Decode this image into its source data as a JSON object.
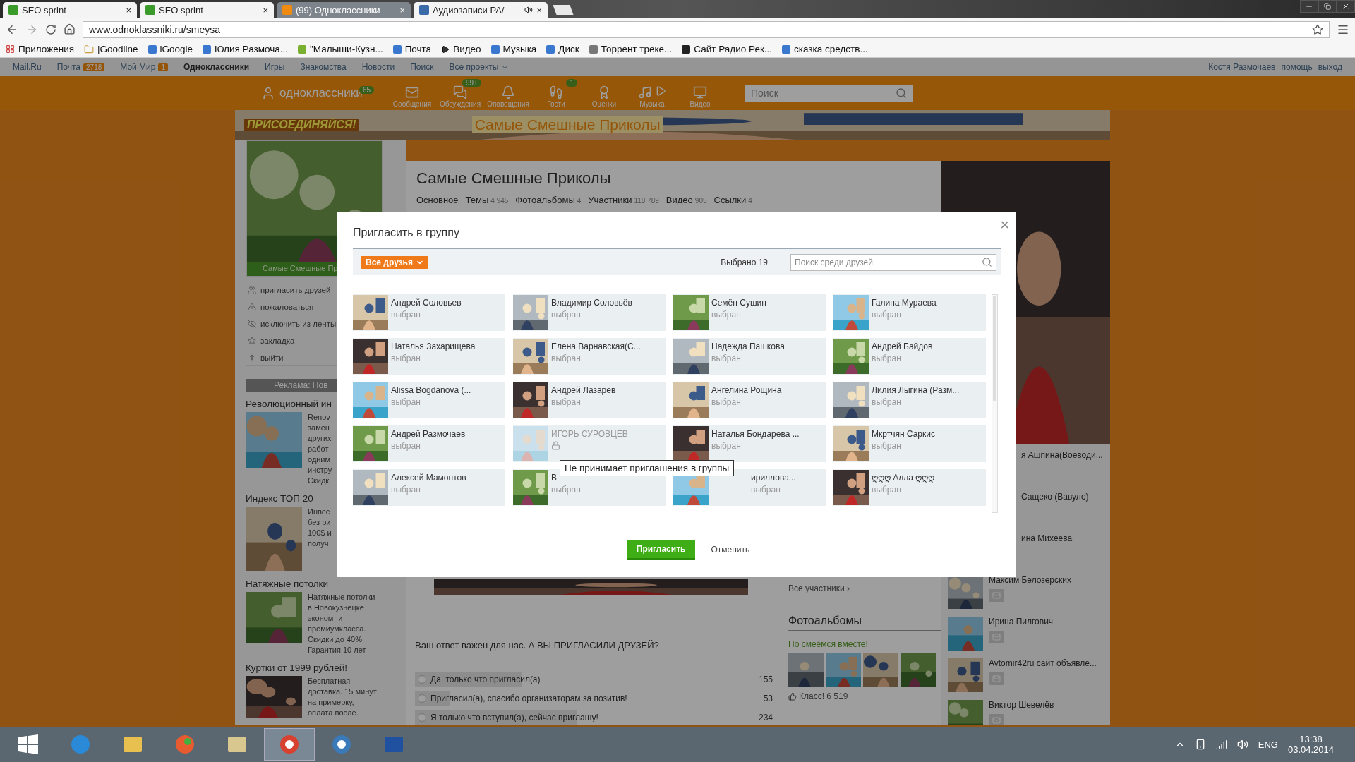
{
  "browser": {
    "tabs": [
      {
        "title": "SEO sprint",
        "kind": "seo",
        "playing": false,
        "close": "×",
        "selected": false
      },
      {
        "title": "SEO sprint",
        "kind": "seo",
        "playing": false,
        "close": "×",
        "selected": false
      },
      {
        "title": "(99) Одноклассники",
        "kind": "ok",
        "playing": false,
        "close": "×",
        "selected": true
      },
      {
        "title": "Аудиозаписи РА/",
        "kind": "audio",
        "playing": true,
        "close": "×",
        "selected": false
      }
    ],
    "address": "www.odnoklassniki.ru/smeysa",
    "bookmarks": [
      {
        "label": "Приложения",
        "kind": "apps"
      },
      {
        "label": "|Goodline",
        "kind": "folder"
      },
      {
        "label": "iGoogle",
        "kind": "site",
        "color": "#3a78d0"
      },
      {
        "label": "Юлия Размоча...",
        "kind": "site",
        "color": "#3a78d0"
      },
      {
        "label": "\"Малыши-Кузн...",
        "kind": "site",
        "color": "#7ab030"
      },
      {
        "label": "Почта",
        "kind": "site",
        "color": "#3a78d0"
      },
      {
        "label": "Видео",
        "kind": "play"
      },
      {
        "label": "Музыка",
        "kind": "site",
        "color": "#3a78d0"
      },
      {
        "label": "Диск",
        "kind": "site",
        "color": "#3a78d0"
      },
      {
        "label": "Торрент треке...",
        "kind": "site",
        "color": "#777777"
      },
      {
        "label": "Сайт Радио Рек...",
        "kind": "site",
        "color": "#222222"
      },
      {
        "label": "сказка средств...",
        "kind": "site",
        "color": "#3a78d0"
      }
    ]
  },
  "top_links": [
    {
      "label": "Mail.Ru",
      "selected": false
    },
    {
      "label": "Почта",
      "badge": "2718",
      "selected": false
    },
    {
      "label": "Мой Мир",
      "badge": "1",
      "selected": false
    },
    {
      "label": "Одноклассники",
      "selected": true
    },
    {
      "label": "Игры",
      "selected": false
    },
    {
      "label": "Знакомства",
      "selected": false
    },
    {
      "label": "Новости",
      "selected": false
    },
    {
      "label": "Поиск",
      "selected": false
    },
    {
      "label": "Все проекты",
      "dropdown": true,
      "selected": false
    }
  ],
  "user_links": [
    "Костя Размочаев",
    "помощь",
    "выход"
  ],
  "header": {
    "logo": "одноклассники",
    "logo_badge": "65",
    "nav": [
      {
        "label": "Сообщения",
        "kind": "mail"
      },
      {
        "label": "Обсуждения",
        "kind": "chat",
        "badge": "99+"
      },
      {
        "label": "Оповещения",
        "kind": "bell"
      },
      {
        "label": "Гости",
        "kind": "steps",
        "badge": "1"
      },
      {
        "label": "Оценки",
        "kind": "medal"
      },
      {
        "label": "Музыка",
        "kind": "music"
      },
      {
        "label": "Видео",
        "kind": "video"
      }
    ],
    "search_placeholder": "Поиск"
  },
  "banner": {
    "slogan": "ПРИСОЕДИНЯЙСЯ!",
    "title": "Самые Смешные Приколы"
  },
  "group": {
    "caption": "Самые Смешные Пр",
    "menu": [
      {
        "label": "пригласить друзей",
        "kind": "users"
      },
      {
        "label": "пожаловаться",
        "kind": "warn"
      },
      {
        "label": "исключить из ленты",
        "kind": "hide"
      },
      {
        "label": "закладка",
        "kind": "star"
      },
      {
        "label": "выйти",
        "kind": "walk"
      }
    ],
    "ads_header": "Реклама: Нов",
    "ads": [
      {
        "title": "Революционный ин",
        "text": "Renov\nзамен\nдругих\nработ\nодним\nинстру\nСкидк"
      },
      {
        "title": "Индекс ТОП 20",
        "text": "Инвес\nбез ри\n100$ и\nполуч"
      },
      {
        "title": "Натяжные потолки",
        "text": "Натяжные потолки\nв Новокузнецке\nэконом- и\nпремиумкласса.\nСкидки до 40%.\nГарантия 10 лет"
      },
      {
        "title": "Куртки от 1999 рублей!",
        "text": "Бесплатная\nдоставка. 15 минут\nна примерку,\nоплата после."
      }
    ],
    "title": "Самые Смешные Приколы",
    "nav": [
      {
        "label": "Основное"
      },
      {
        "label": "Темы",
        "count": "4 945"
      },
      {
        "label": "Фотоальбомы",
        "count": "4"
      },
      {
        "label": "Участники",
        "count": "118 789"
      },
      {
        "label": "Видео",
        "count": "905"
      },
      {
        "label": "Ссылки",
        "count": "4"
      }
    ],
    "poll": {
      "question": "Ваш ответ важен для нас. А ВЫ ПРИГЛАСИЛИ ДРУЗЕЙ?",
      "options": [
        {
          "label": "Да, только что пригласил(а)",
          "count": "155",
          "level": 0.33,
          "checked": false
        },
        {
          "label": "Пригласил(а), спасибо организаторам за позитив!",
          "count": "53",
          "level": 0.11,
          "checked": false
        },
        {
          "label": "Я только что вступил(а), сейчас приглашу!",
          "count": "234",
          "level": 0.5,
          "checked": false
        }
      ]
    },
    "all_members": "Все участники ›",
    "albums_title": "Фотоальбомы",
    "album_name": "По смеёмся вместе!",
    "klass": "Класс! 6 519",
    "members": [
      {
        "name": "я Ашпина(Воеводи...",
        "kind": "cut"
      },
      {
        "name": "Сащеко (Вавуло)",
        "kind": "cut"
      },
      {
        "name": "ина Михеева",
        "kind": "cut"
      },
      {
        "name": "Максим Белозерских",
        "kind": "full"
      },
      {
        "name": "Ирина Пилгович",
        "kind": "full"
      },
      {
        "name": "Avtomir42ru сайт объявле...",
        "kind": "full"
      },
      {
        "name": "Виктор Шевелёв",
        "kind": "full"
      }
    ]
  },
  "dialog": {
    "title": "Пригласить в группу",
    "close": "×",
    "filter": "Все друзья",
    "selected_count": "Выбрано 19",
    "search_placeholder": "Поиск среди друзей",
    "friends": [
      {
        "name": "Андрей Соловьев",
        "status": "выбран",
        "disabled": false
      },
      {
        "name": "Владимир Соловьёв",
        "status": "выбран",
        "disabled": false
      },
      {
        "name": "Семён Сушин",
        "status": "выбран",
        "disabled": false
      },
      {
        "name": "Галина Мураева",
        "status": "выбран",
        "disabled": false
      },
      {
        "name": "Наталья Захарищева",
        "status": "выбран",
        "disabled": false
      },
      {
        "name": "Елена Варнавская(С...",
        "status": "выбран",
        "disabled": false
      },
      {
        "name": "Надежда Пашкова",
        "status": "выбран",
        "disabled": false
      },
      {
        "name": "Андрей Байдов",
        "status": "выбран",
        "disabled": false
      },
      {
        "name": "Alissa Bogdanova (...",
        "status": "выбран",
        "disabled": false
      },
      {
        "name": "Андрей Лазарев",
        "status": "выбран",
        "disabled": false
      },
      {
        "name": "Ангелина Рощина",
        "status": "выбран",
        "disabled": false
      },
      {
        "name": "Лилия Лыгина (Разм...",
        "status": "выбран",
        "disabled": false
      },
      {
        "name": "Андрей Размочаев",
        "status": "выбран",
        "disabled": false
      },
      {
        "name": "ИГОРЬ СУРОВЦЕВ",
        "disabled": true
      },
      {
        "name": "Наталья Бондарева ...",
        "status": "выбран",
        "disabled": false
      },
      {
        "name": "Мкртчян Саркис",
        "status": "выбран",
        "disabled": false
      },
      {
        "name": "Алексей Мамонтов",
        "status": "выбран",
        "disabled": false
      },
      {
        "name": "В",
        "status": "выбран",
        "disabled": false
      },
      {
        "name": "ириллова...",
        "status": "выбран",
        "disabled": false,
        "partly_covered": true
      },
      {
        "name": "ღღღ Алла ღღღ",
        "status": "выбран",
        "disabled": false
      }
    ],
    "tooltip": "Не принимает приглашения в группы",
    "invite": "Пригласить",
    "cancel": "Отменить"
  },
  "taskbar": {
    "apps": [
      {
        "kind": "ie",
        "selected": false
      },
      {
        "kind": "folder",
        "selected": false
      },
      {
        "kind": "paint",
        "selected": false
      },
      {
        "kind": "notes",
        "selected": false
      },
      {
        "kind": "chrome",
        "selected": true
      },
      {
        "kind": "disc",
        "selected": false
      },
      {
        "kind": "asus",
        "selected": false
      }
    ],
    "lang": "ENG",
    "time": "13:38",
    "date": "03.04.2014"
  }
}
